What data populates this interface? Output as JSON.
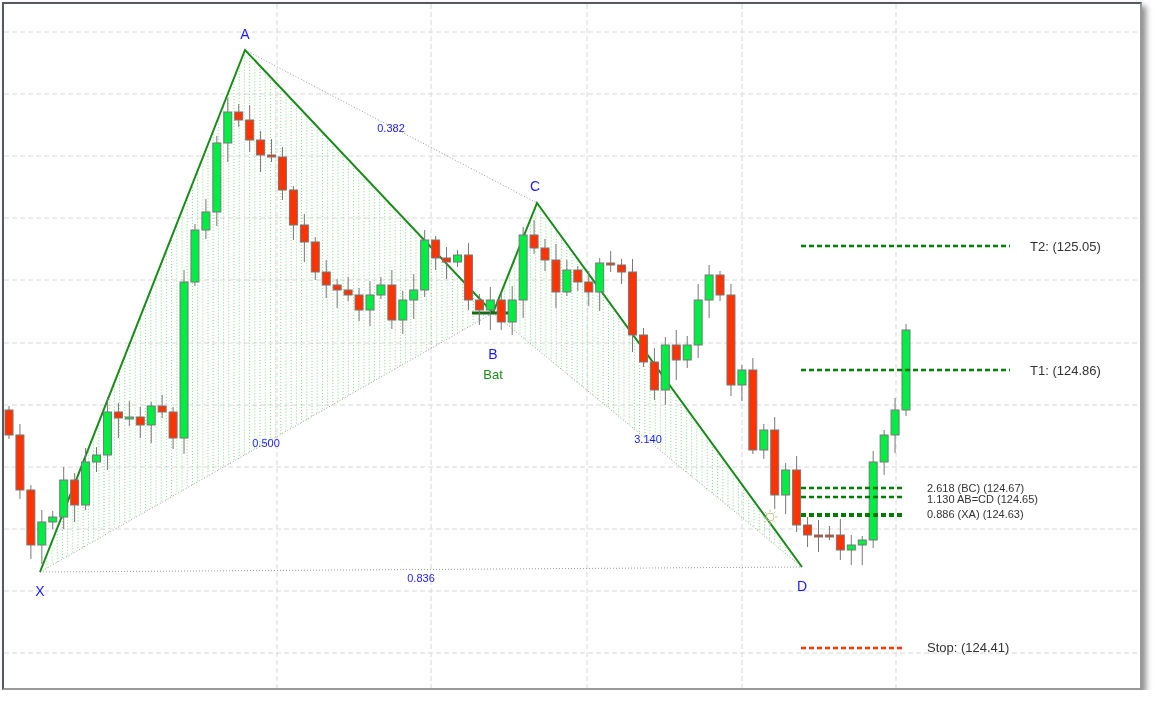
{
  "chart": {
    "points": [
      {
        "label": "X"
      },
      {
        "label": "A"
      },
      {
        "label": "B"
      },
      {
        "label": "C"
      },
      {
        "label": "D"
      }
    ],
    "pattern_name": "Bat",
    "ratios": [
      {
        "label": "0.382"
      },
      {
        "label": "0.500"
      },
      {
        "label": "3.140"
      },
      {
        "label": "0.836"
      }
    ],
    "levels": [
      {
        "label": "T2: (125.05)",
        "kind": "target"
      },
      {
        "label": "T1: (124.86)",
        "kind": "target"
      },
      {
        "label": "2.618 (BC) (124.67)",
        "kind": "entry"
      },
      {
        "label": "1.130 AB=CD (124.65)",
        "kind": "entry"
      },
      {
        "label": "0.886 (XA) (124.63)",
        "kind": "entry-strong"
      },
      {
        "label": "Stop: (124.41)",
        "kind": "stop"
      }
    ]
  }
}
